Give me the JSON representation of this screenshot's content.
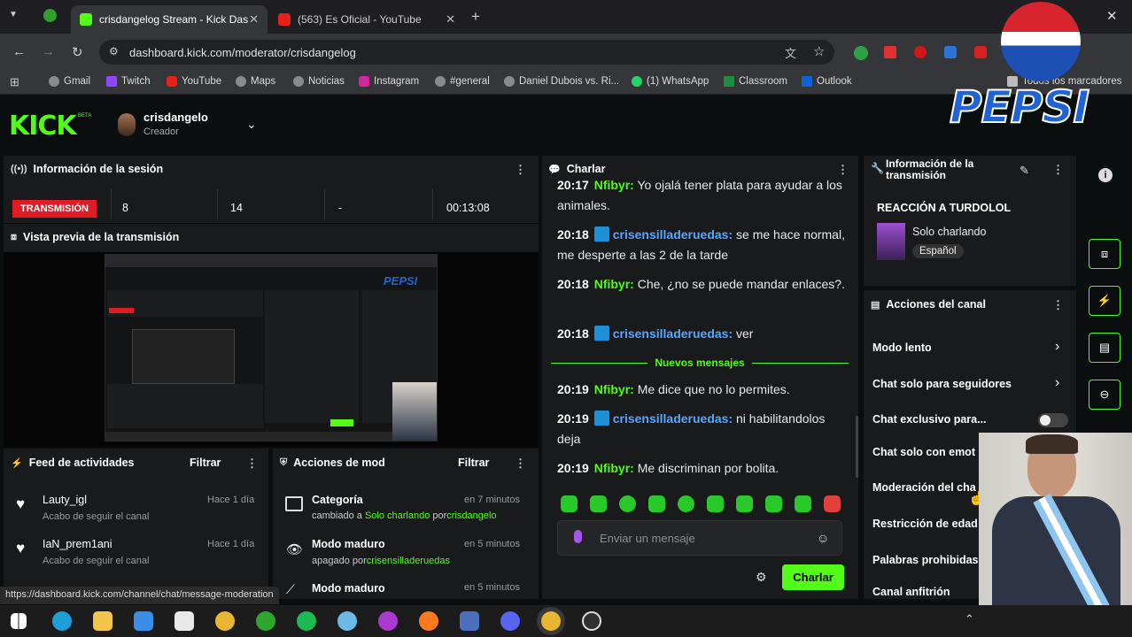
{
  "browser": {
    "tabs": [
      {
        "title": "crisdangelog Stream - Kick Das",
        "active": true
      },
      {
        "title": "(563) Es Oficial - YouTube",
        "active": false
      }
    ],
    "url": "dashboard.kick.com/moderator/crisdangelog",
    "bookmarks": [
      "Gmail",
      "Twitch",
      "YouTube",
      "Maps",
      "Noticias",
      "Instagram",
      "#general",
      "Daniel Dubois vs. Ri...",
      "(1) WhatsApp",
      "Classroom",
      "Outlook"
    ],
    "all_bookmarks": "Todos los marcadores",
    "status_url": "https://dashboard.kick.com/channel/chat/message-moderation"
  },
  "header": {
    "logo": "KICK",
    "beta": "BETA",
    "username": "crisdangelo",
    "role": "Creador"
  },
  "session": {
    "title": "Información de la sesión",
    "live_label": "TRANSMISIÓN",
    "viewers": "8",
    "followers": "14",
    "subs": "-",
    "duration": "00:13:08"
  },
  "preview": {
    "title": "Vista previa de la transmisión"
  },
  "activity": {
    "title": "Feed de actividades",
    "filter": "Filtrar",
    "items": [
      {
        "name": "Lauty_igl",
        "desc": "Acabo de seguir el canal",
        "time": "Hace 1 día"
      },
      {
        "name": "IaN_prem1ani",
        "desc": "Acabo de seguir el canal",
        "time": "Hace 1 día"
      }
    ]
  },
  "modactions": {
    "title": "Acciones de mod",
    "filter": "Filtrar",
    "items": [
      {
        "title": "Categoría",
        "pre": "cambiado a ",
        "hl": "Solo charlando",
        "mid": " por",
        "who": "crisdangelo",
        "time": "en 7 minutos"
      },
      {
        "title": "Modo maduro",
        "pre": "apagado por",
        "hl": "",
        "mid": "",
        "who": "crisensilladeruedas",
        "time": "en 5 minutos"
      },
      {
        "title": "Modo maduro",
        "pre": "",
        "hl": "",
        "mid": "",
        "who": "",
        "time": "en 5 minutos"
      }
    ]
  },
  "chat": {
    "title": "Charlar",
    "messages": [
      {
        "time": "20:17",
        "user": "Nfibyr",
        "text": "Yo ojalá tener plata para ayudar a los animales.",
        "badge": false
      },
      {
        "time": "20:18",
        "user": "crisensilladeruedas",
        "text": "se me hace normal, me desperte a las 2 de la tarde",
        "badge": true
      },
      {
        "time": "20:18",
        "user": "Nfibyr",
        "text": "Che, ¿no se puede mandar enlaces?.",
        "badge": false
      },
      {
        "time": "20:18",
        "user": "crisensilladeruedas",
        "text": "ver",
        "badge": true
      },
      {
        "time": "20:19",
        "user": "Nfibyr",
        "text": "Me dice que no lo permites.",
        "badge": false
      },
      {
        "time": "20:19",
        "user": "crisensilladeruedas",
        "text": "ni habilitandolos deja",
        "badge": true
      },
      {
        "time": "20:19",
        "user": "Nfibyr",
        "text": "Me discriminan por bolita.",
        "badge": false
      }
    ],
    "new_messages": "Nuevos mensajes",
    "placeholder": "Enviar un mensaje",
    "send": "Charlar"
  },
  "streaminfo": {
    "title1": "Información de la",
    "title2": "transmisión",
    "stream_title": "REACCIÓN A TURDOLOL",
    "category": "Solo charlando",
    "language": "Español"
  },
  "channel_actions": {
    "title": "Acciones del canal",
    "items": [
      "Modo lento",
      "Chat solo para seguidores",
      "Chat exclusivo para...",
      "Chat solo con emot",
      "Moderación del cha",
      "Restricción de edad",
      "Palabras prohibidas",
      "Canal anfitrión"
    ]
  },
  "overlay": {
    "brand": "PEPSI"
  },
  "colors": {
    "accent": "#53fc18",
    "live": "#e01b24",
    "username_blue": "#5aa7ff"
  }
}
